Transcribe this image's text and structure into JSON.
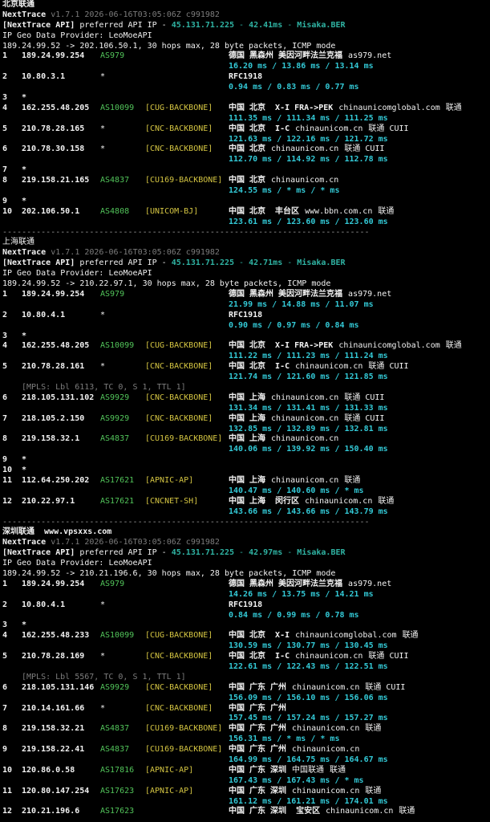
{
  "sections": [
    {
      "title": "北京联通",
      "title_bold": true,
      "app_name": "NextTrace",
      "version_line": "v1.7.1 2026-06-16T03:05:06Z c991982",
      "api_prefix": "[NextTrace API]",
      "api_mid": " preferred API IP - ",
      "api_ip": "45.131.71.225",
      "api_dash": " - ",
      "api_latency": "42.41ms",
      "api_dash2": " - ",
      "api_host": "Misaka.BER",
      "geo_provider": "IP Geo Data Provider: LeoMoeAPI",
      "trace_line": "189.24.99.52 -> 202.106.50.1, 30 hops max, 28 byte packets, ICMP mode",
      "hops": [
        {
          "n": "1",
          "ip": "189.24.99.254",
          "asn": "AS979",
          "tag": "",
          "geo": "德国 黑森州 美因河畔法兰克福",
          "extra": "as979.net",
          "isp": "",
          "rtt": "16.20 ms / 13.86 ms / 13.14 ms"
        },
        {
          "n": "2",
          "ip": "10.80.3.1",
          "asn": "*",
          "tag": "",
          "geo": "RFC1918",
          "extra": "",
          "isp": "",
          "rtt": "0.94 ms / 0.83 ms / 0.77 ms"
        },
        {
          "n": "3",
          "ip": "*",
          "asn": "",
          "tag": "",
          "geo": "",
          "extra": "",
          "isp": "",
          "rtt": ""
        },
        {
          "n": "4",
          "ip": "162.255.48.205",
          "asn": "AS10099",
          "tag": "[CUG-BACKBONE]",
          "geo": "中国 北京  X-I FRA->PEK",
          "extra": "chinaunicomglobal.com",
          "isp": "联通",
          "rtt": "111.35 ms / 111.34 ms / 111.25 ms"
        },
        {
          "n": "5",
          "ip": "210.78.28.165",
          "asn": "*",
          "tag": "[CNC-BACKBONE]",
          "geo": "中国 北京  I-C",
          "extra": "chinaunicom.cn",
          "isp": "联通 CUII",
          "rtt": "121.63 ms / 122.16 ms / 121.72 ms"
        },
        {
          "n": "6",
          "ip": "210.78.30.158",
          "asn": "*",
          "tag": "[CNC-BACKBONE]",
          "geo": "中国 北京",
          "extra": "chinaunicom.cn",
          "isp": "联通 CUII",
          "rtt": "112.70 ms / 114.92 ms / 112.78 ms"
        },
        {
          "n": "7",
          "ip": "*",
          "asn": "",
          "tag": "",
          "geo": "",
          "extra": "",
          "isp": "",
          "rtt": ""
        },
        {
          "n": "8",
          "ip": "219.158.21.165",
          "asn": "AS4837",
          "tag": "[CU169-BACKBONE]",
          "geo": "中国 北京",
          "extra": "chinaunicom.cn",
          "isp": "",
          "rtt": "124.55 ms / * ms / * ms"
        },
        {
          "n": "9",
          "ip": "*",
          "asn": "",
          "tag": "",
          "geo": "",
          "extra": "",
          "isp": "",
          "rtt": ""
        },
        {
          "n": "10",
          "ip": "202.106.50.1",
          "asn": "AS4808",
          "tag": "[UNICOM-BJ]",
          "geo": "中国 北京  丰台区",
          "extra": "www.bbn.com.cn",
          "isp": "联通",
          "rtt": "123.61 ms / 123.60 ms / 123.60 ms"
        }
      ],
      "separator": "----------------------------------------------------------------------------"
    },
    {
      "title": "上海联通",
      "title_bold": false,
      "app_name": "NextTrace",
      "version_line": "v1.7.1 2026-06-16T03:05:06Z c991982",
      "api_prefix": "[NextTrace API]",
      "api_mid": " preferred API IP - ",
      "api_ip": "45.131.71.225",
      "api_dash": " - ",
      "api_latency": "42.71ms",
      "api_dash2": " - ",
      "api_host": "Misaka.BER",
      "geo_provider": "IP Geo Data Provider: LeoMoeAPI",
      "trace_line": "189.24.99.52 -> 210.22.97.1, 30 hops max, 28 byte packets, ICMP mode",
      "hops": [
        {
          "n": "1",
          "ip": "189.24.99.254",
          "asn": "AS979",
          "tag": "",
          "geo": "德国 黑森州 美因河畔法兰克福",
          "extra": "as979.net",
          "isp": "",
          "rtt": "21.99 ms / 14.88 ms / 11.07 ms"
        },
        {
          "n": "2",
          "ip": "10.80.4.1",
          "asn": "*",
          "tag": "",
          "geo": "RFC1918",
          "extra": "",
          "isp": "",
          "rtt": "0.90 ms / 0.97 ms / 0.84 ms"
        },
        {
          "n": "3",
          "ip": "*",
          "asn": "",
          "tag": "",
          "geo": "",
          "extra": "",
          "isp": "",
          "rtt": ""
        },
        {
          "n": "4",
          "ip": "162.255.48.205",
          "asn": "AS10099",
          "tag": "[CUG-BACKBONE]",
          "geo": "中国 北京  X-I FRA->PEK",
          "extra": "chinaunicomglobal.com",
          "isp": "联通",
          "rtt": "111.22 ms / 111.23 ms / 111.24 ms"
        },
        {
          "n": "5",
          "ip": "210.78.28.161",
          "asn": "*",
          "tag": "[CNC-BACKBONE]",
          "geo": "中国 北京  I-C",
          "extra": "chinaunicom.cn",
          "isp": "联通 CUII",
          "rtt": "121.74 ms / 121.60 ms / 121.85 ms"
        },
        {
          "n": "6",
          "ip": "218.105.131.102",
          "asn": "AS9929",
          "tag": "[CNC-BACKBONE]",
          "geo": "中国 上海",
          "extra": "chinaunicom.cn",
          "isp": "联通 CUII",
          "rtt": "131.34 ms / 131.41 ms / 131.33 ms",
          "mpls": "[MPLS: Lbl 6113, TC 0, S 1, TTL 1]"
        },
        {
          "n": "7",
          "ip": "218.105.2.150",
          "asn": "AS9929",
          "tag": "[CNC-BACKBONE]",
          "geo": "中国 上海",
          "extra": "chinaunicom.cn",
          "isp": "联通 CUII",
          "rtt": "132.85 ms / 132.89 ms / 132.81 ms"
        },
        {
          "n": "8",
          "ip": "219.158.32.1",
          "asn": "AS4837",
          "tag": "[CU169-BACKBONE]",
          "geo": "中国 上海",
          "extra": "chinaunicom.cn",
          "isp": "",
          "rtt": "140.06 ms / 139.92 ms / 150.40 ms"
        },
        {
          "n": "9",
          "ip": "*",
          "asn": "",
          "tag": "",
          "geo": "",
          "extra": "",
          "isp": "",
          "rtt": ""
        },
        {
          "n": "10",
          "ip": "*",
          "asn": "",
          "tag": "",
          "geo": "",
          "extra": "",
          "isp": "",
          "rtt": ""
        },
        {
          "n": "11",
          "ip": "112.64.250.202",
          "asn": "AS17621",
          "tag": "[APNIC-AP]",
          "geo": "中国 上海",
          "extra": "chinaunicom.cn",
          "isp": "联通",
          "rtt": "140.47 ms / 140.60 ms / * ms"
        },
        {
          "n": "12",
          "ip": "210.22.97.1",
          "asn": "AS17621",
          "tag": "[CNCNET-SH]",
          "geo": "中国 上海  闵行区",
          "extra": "chinaunicom.cn",
          "isp": "联通",
          "rtt": "143.66 ms / 143.66 ms / 143.79 ms"
        }
      ],
      "separator": "----------------------------------------------------------------------------"
    },
    {
      "title": "深圳联通  www.vpsxxs.com",
      "title_bold": true,
      "app_name": "NextTrace",
      "version_line": "v1.7.1 2026-06-16T03:05:06Z c991982",
      "api_prefix": "[NextTrace API]",
      "api_mid": " preferred API IP - ",
      "api_ip": "45.131.71.225",
      "api_dash": " - ",
      "api_latency": "42.97ms",
      "api_dash2": " - ",
      "api_host": "Misaka.BER",
      "geo_provider": "IP Geo Data Provider: LeoMoeAPI",
      "trace_line": "189.24.99.52 -> 210.21.196.6, 30 hops max, 28 byte packets, ICMP mode",
      "hops": [
        {
          "n": "1",
          "ip": "189.24.99.254",
          "asn": "AS979",
          "tag": "",
          "geo": "德国 黑森州 美因河畔法兰克福",
          "extra": "as979.net",
          "isp": "",
          "rtt": "14.26 ms / 13.75 ms / 14.21 ms"
        },
        {
          "n": "2",
          "ip": "10.80.4.1",
          "asn": "*",
          "tag": "",
          "geo": "RFC1918",
          "extra": "",
          "isp": "",
          "rtt": "0.84 ms / 0.99 ms / 0.78 ms"
        },
        {
          "n": "3",
          "ip": "*",
          "asn": "",
          "tag": "",
          "geo": "",
          "extra": "",
          "isp": "",
          "rtt": ""
        },
        {
          "n": "4",
          "ip": "162.255.48.233",
          "asn": "AS10099",
          "tag": "[CUG-BACKBONE]",
          "geo": "中国 北京  X-I",
          "extra": "chinaunicomglobal.com",
          "isp": "联通",
          "rtt": "130.59 ms / 130.77 ms / 130.45 ms"
        },
        {
          "n": "5",
          "ip": "210.78.28.169",
          "asn": "*",
          "tag": "[CNC-BACKBONE]",
          "geo": "中国 北京  I-C",
          "extra": "chinaunicom.cn",
          "isp": "联通 CUII",
          "rtt": "122.61 ms / 122.43 ms / 122.51 ms"
        },
        {
          "n": "6",
          "ip": "218.105.131.146",
          "asn": "AS9929",
          "tag": "[CNC-BACKBONE]",
          "geo": "中国 广东 广州",
          "extra": "chinaunicom.cn",
          "isp": "联通 CUII",
          "rtt": "156.09 ms / 156.10 ms / 156.06 ms",
          "mpls": "[MPLS: Lbl 5567, TC 0, S 1, TTL 1]"
        },
        {
          "n": "7",
          "ip": "210.14.161.66",
          "asn": "*",
          "tag": "[CNC-BACKBONE]",
          "geo": "中国 广东 广州",
          "extra": "",
          "isp": "",
          "rtt": "157.45 ms / 157.24 ms / 157.27 ms"
        },
        {
          "n": "8",
          "ip": "219.158.32.21",
          "asn": "AS4837",
          "tag": "[CU169-BACKBONE]",
          "geo": "中国 广东 广州",
          "extra": "chinaunicom.cn",
          "isp": "联通",
          "rtt": "156.31 ms / * ms / * ms"
        },
        {
          "n": "9",
          "ip": "219.158.22.41",
          "asn": "AS4837",
          "tag": "[CU169-BACKBONE]",
          "geo": "中国 广东 广州",
          "extra": "chinaunicom.cn",
          "isp": "",
          "rtt": "164.99 ms / 164.75 ms / 164.67 ms"
        },
        {
          "n": "10",
          "ip": "120.86.0.58",
          "asn": "AS17816",
          "tag": "[APNIC-AP]",
          "geo": "中国 广东 深圳",
          "extra": "中国联通",
          "isp": "联通",
          "rtt": "167.43 ms / 167.43 ms / * ms"
        },
        {
          "n": "11",
          "ip": "120.80.147.254",
          "asn": "AS17623",
          "tag": "[APNIC-AP]",
          "geo": "中国 广东 深圳",
          "extra": "chinaunicom.cn",
          "isp": "联通",
          "rtt": "161.12 ms / 161.21 ms / 174.01 ms"
        },
        {
          "n": "12",
          "ip": "210.21.196.6",
          "asn": "AS17623",
          "tag": "",
          "geo": "中国 广东 深圳  宝安区",
          "extra": "chinaunicom.cn",
          "isp": "联通",
          "rtt": ""
        }
      ],
      "separator": ""
    }
  ],
  "colors": {
    "background": "#000000",
    "text": "#e8e8e8",
    "dim": "#7c7c7c",
    "asn": "#52c45a",
    "tag": "#d4c542",
    "rtt": "#33c9d6",
    "api": "#2fb3a3"
  }
}
